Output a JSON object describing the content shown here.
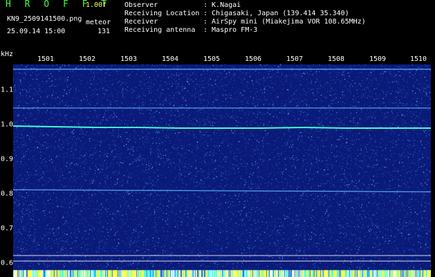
{
  "header": {
    "app_title": "H R O F F T",
    "version": "1.00f",
    "filename": "KN9_2509141500.png",
    "mode": "meteor",
    "datetime": "25.09.14 15:00",
    "count": "131"
  },
  "meta": [
    {
      "key": "Observer",
      "value": ": K.Nagai"
    },
    {
      "key": "Receiving Location",
      "value": ": Chigasaki, Japan (139.414 35.340)"
    },
    {
      "key": "Receiver",
      "value": ": AirSpy mini (Miakejima VOR 108.65MHz)"
    },
    {
      "key": "Receiving antenna",
      "value": ": Maspro FM-3"
    }
  ],
  "axis": {
    "unit": "kHz",
    "x_ticks": [
      "1501",
      "1502",
      "1503",
      "1504",
      "1505",
      "1506",
      "1507",
      "1508",
      "1509",
      "1510"
    ],
    "y_ticks": [
      "1.1",
      "1.0",
      "0.9",
      "0.8",
      "0.7",
      "0.6"
    ]
  },
  "colors": {
    "background": "#000000",
    "spectrogram": "#0a1a78",
    "title": "#3cff3c",
    "version": "#ffff40",
    "carrier": "#40ffd0"
  }
}
